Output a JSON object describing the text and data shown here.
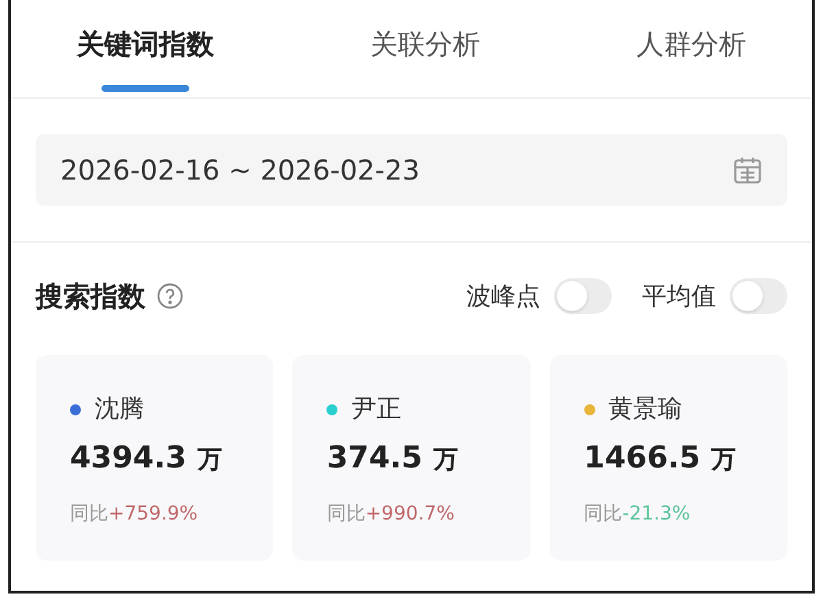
{
  "tabs": [
    {
      "label": "关键词指数",
      "selected": true
    },
    {
      "label": "关联分析",
      "selected": false
    },
    {
      "label": "人群分析",
      "selected": false
    }
  ],
  "date_range": {
    "value": "2026-02-16 ~ 2026-02-23"
  },
  "section": {
    "title": "搜索指数",
    "toggles": [
      {
        "label": "波峰点",
        "on": false
      },
      {
        "label": "平均值",
        "on": false
      }
    ]
  },
  "cards": [
    {
      "name": "沈腾",
      "color": "#3b6fd8",
      "value": "4394.3",
      "unit": "万",
      "change_label": "同比",
      "change": "+759.9%",
      "kind": "rise"
    },
    {
      "name": "尹正",
      "color": "#2ccfd0",
      "value": "374.5",
      "unit": "万",
      "change_label": "同比",
      "change": "+990.7%",
      "kind": "rise"
    },
    {
      "name": "黄景瑜",
      "color": "#e8b43a",
      "value": "1466.5",
      "unit": "万",
      "change_label": "同比",
      "change": "-21.3%",
      "kind": "fall"
    }
  ]
}
